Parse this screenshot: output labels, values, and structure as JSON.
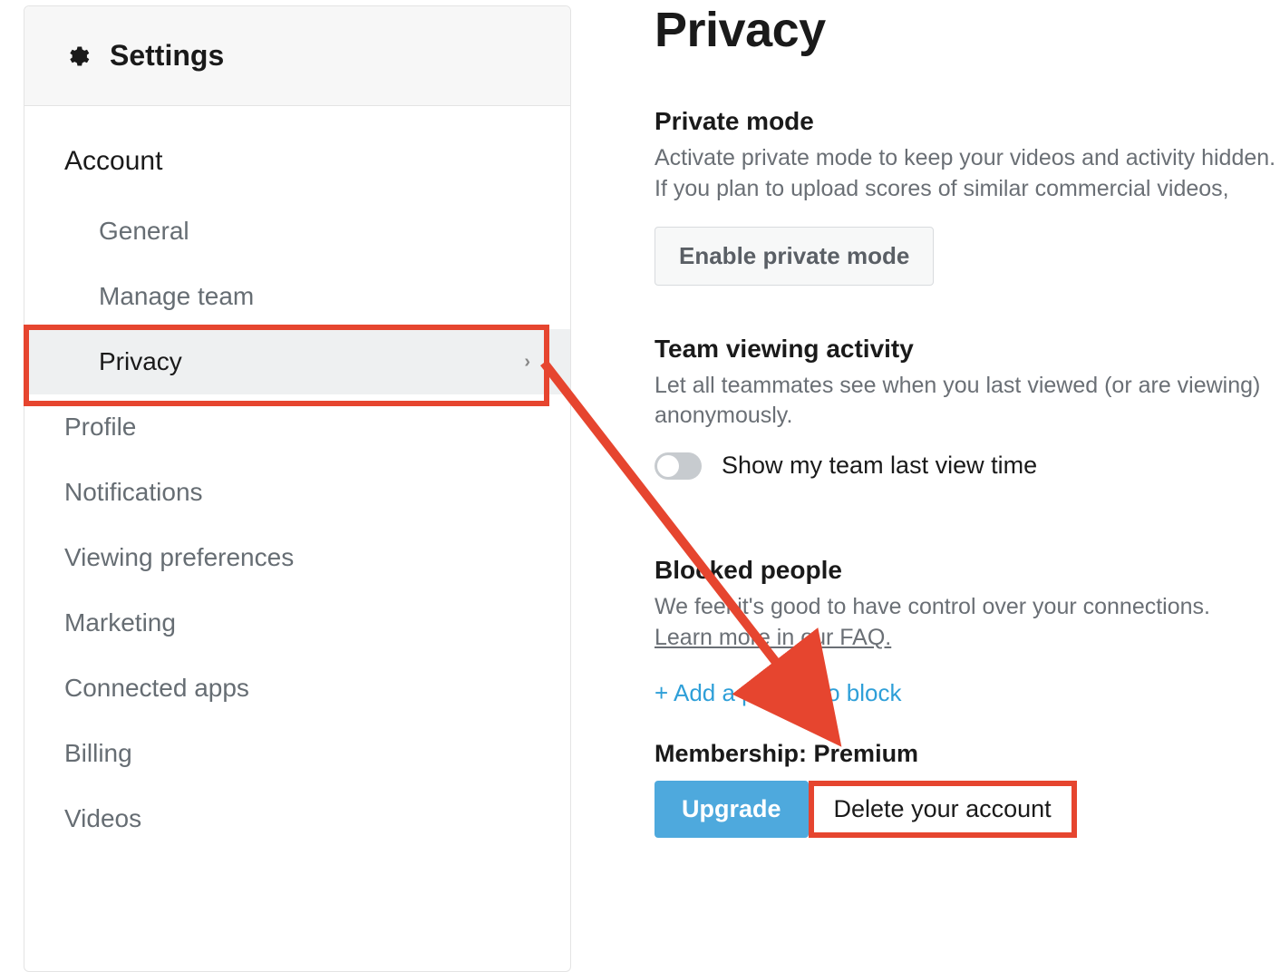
{
  "sidebar": {
    "title": "Settings",
    "section_label": "Account",
    "items": [
      {
        "label": "General"
      },
      {
        "label": "Manage team"
      },
      {
        "label": "Privacy",
        "active": true
      }
    ],
    "top_items": [
      {
        "label": "Profile"
      },
      {
        "label": "Notifications"
      },
      {
        "label": "Viewing preferences"
      },
      {
        "label": "Marketing"
      },
      {
        "label": "Connected apps"
      },
      {
        "label": "Billing"
      },
      {
        "label": "Videos"
      }
    ]
  },
  "main": {
    "title": "Privacy",
    "private_mode": {
      "heading": "Private mode",
      "description": "Activate private mode to keep your videos and activity hidden. If you plan to upload scores of similar commercial videos,",
      "button": "Enable private mode"
    },
    "team_viewing": {
      "heading": "Team viewing activity",
      "description": "Let all teammates see when you last viewed (or are viewing) anonymously.",
      "toggle_label": "Show my team last view time"
    },
    "blocked_people": {
      "heading": "Blocked people",
      "description": "We feel it's good to have control over your connections.",
      "faq_link": "Learn more in our FAQ.",
      "add_label": "+ Add a person to block"
    },
    "membership": {
      "heading": "Membership: Premium",
      "upgrade": "Upgrade",
      "delete": "Delete your account"
    }
  }
}
